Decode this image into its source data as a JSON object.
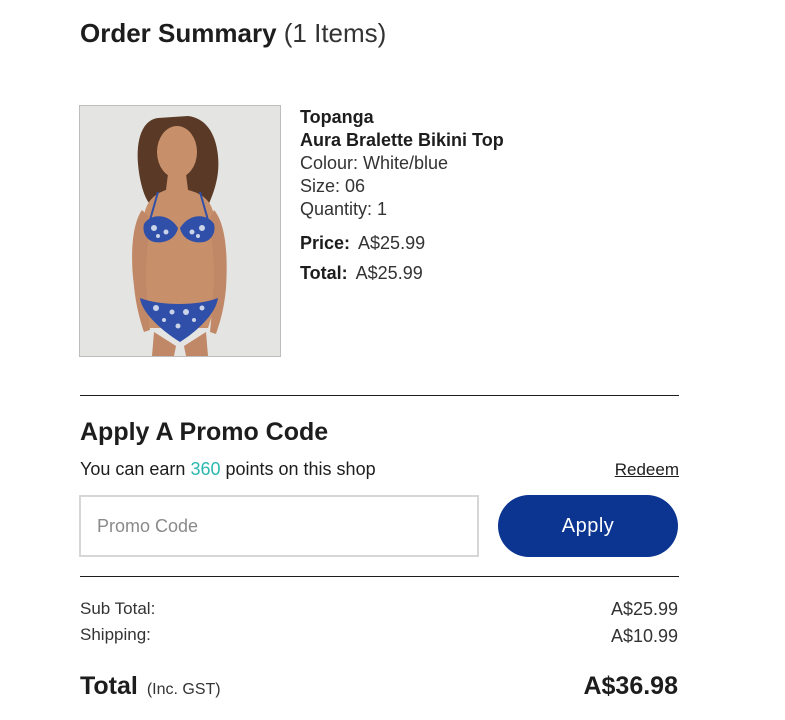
{
  "order_summary": {
    "title": "Order Summary",
    "items_count": "(1 Items)"
  },
  "product": {
    "image_icon": "product-photo-bikini",
    "brand": "Topanga",
    "name": "Aura Bralette Bikini Top",
    "colour": "Colour: White/blue",
    "size": "Size: 06",
    "quantity": "Quantity: 1",
    "price_label": "Price:",
    "price_value": "A$25.99",
    "total_label": "Total:",
    "total_value": "A$25.99"
  },
  "promo": {
    "heading": "Apply A Promo Code",
    "earn_prefix": "You can earn ",
    "earn_points": "360",
    "earn_suffix": " points on this shop",
    "redeem_label": "Redeem",
    "input_placeholder": "Promo Code",
    "input_value": "",
    "apply_label": "Apply",
    "accent_color": "#2cb8b0",
    "button_color": "#0b3590"
  },
  "totals": {
    "subtotal_label": "Sub Total:",
    "subtotal_value": "A$25.99",
    "shipping_label": "Shipping:",
    "shipping_value": "A$10.99",
    "total_label": "Total",
    "total_note": "(Inc. GST)",
    "total_value": "A$36.98"
  }
}
